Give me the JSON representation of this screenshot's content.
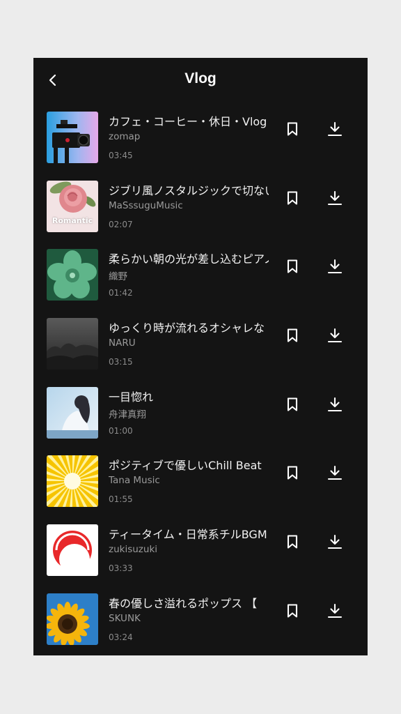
{
  "header": {
    "title": "Vlog",
    "back_icon": "chevron-left-icon"
  },
  "tracks": [
    {
      "title": "カフェ・コーヒー・休日・Vlog",
      "artist": "zomap",
      "duration": "03:45",
      "thumb": "camera"
    },
    {
      "title": "ジブリ風ノスタルジックで切ない",
      "artist": "MaSssuguMusic",
      "duration": "02:07",
      "thumb": "rose",
      "thumb_label": "Romantic"
    },
    {
      "title": "柔らかい朝の光が差し込むピアノ",
      "artist": "織野",
      "duration": "01:42",
      "thumb": "flower"
    },
    {
      "title": "ゆっくり時が流れるオシャレな",
      "artist": "NARU",
      "duration": "03:15",
      "thumb": "mist"
    },
    {
      "title": "一目惚れ",
      "artist": "舟津真翔",
      "duration": "01:00",
      "thumb": "girl"
    },
    {
      "title": "ポジティブで優しいChill Beat",
      "artist": "Tana Music",
      "duration": "01:55",
      "thumb": "sunburst"
    },
    {
      "title": "ティータイム・日常系チルBGM",
      "artist": "zukisuzuki",
      "duration": "03:33",
      "thumb": "redlogo"
    },
    {
      "title": "春の優しさ溢れるポップス 【",
      "artist": "SKUNK",
      "duration": "03:24",
      "thumb": "sunflower"
    }
  ],
  "icons": {
    "bookmark": "bookmark-icon",
    "download": "download-icon"
  },
  "colors": {
    "background": "#141414",
    "text": "#f2f2f2",
    "muted": "#9a9a9a"
  }
}
